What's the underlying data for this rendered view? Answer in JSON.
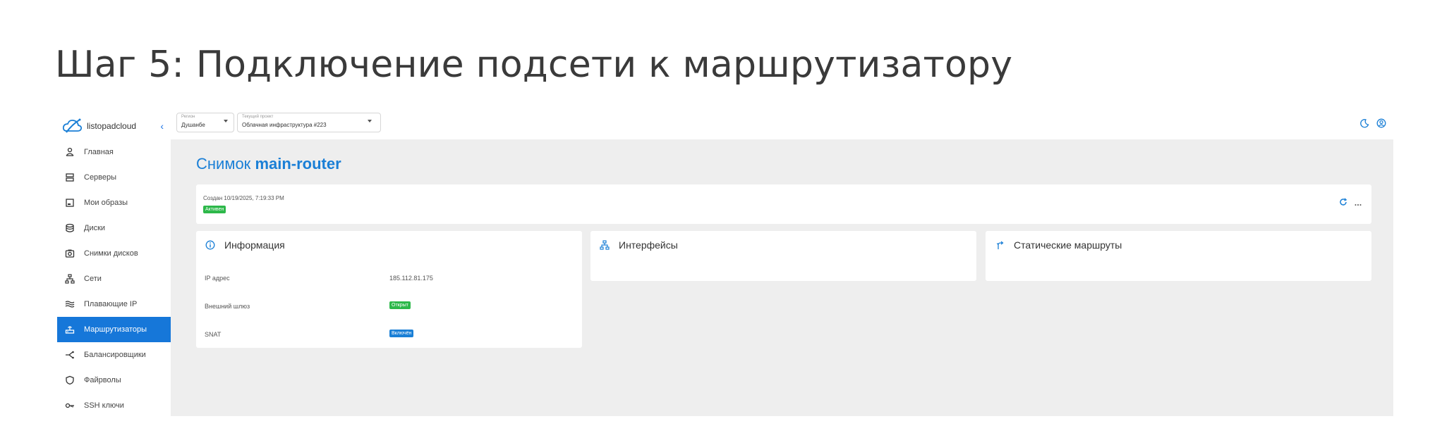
{
  "slide": {
    "title": "Шаг 5: Подключение подсети к маршрутизатору"
  },
  "brand": {
    "name": "listopadcloud",
    "collapse_icon": "chevron-left-icon"
  },
  "sidebar": {
    "items": [
      {
        "label": "Главная",
        "icon": "user-icon"
      },
      {
        "label": "Серверы",
        "icon": "server-icon"
      },
      {
        "label": "Мои образы",
        "icon": "image-icon"
      },
      {
        "label": "Диски",
        "icon": "database-icon"
      },
      {
        "label": "Снимки дисков",
        "icon": "camera-icon"
      },
      {
        "label": "Сети",
        "icon": "network-icon"
      },
      {
        "label": "Плавающие IP",
        "icon": "waves-icon"
      },
      {
        "label": "Маршрутизаторы",
        "icon": "router-icon",
        "active": true
      },
      {
        "label": "Балансировщики",
        "icon": "balancer-icon"
      },
      {
        "label": "Файрволы",
        "icon": "shield-icon"
      },
      {
        "label": "SSH ключи",
        "icon": "key-icon"
      }
    ]
  },
  "topbar": {
    "region_label": "Регион",
    "region_value": "Душанбе",
    "project_label": "Текущий проект",
    "project_value": "Облачная инфраструктура #223"
  },
  "main": {
    "title_prefix": "Снимок",
    "title_name": "main-router",
    "created": "Создан 10/19/2025, 7:19:33 PM",
    "status_badge": "Активен",
    "info": {
      "title": "Информация",
      "rows": [
        {
          "label": "IP адрес",
          "value": "185.112.81.175"
        },
        {
          "label": "Внешний шлюз",
          "badge": "Открыт"
        },
        {
          "label": "SNAT",
          "badge": "Включён"
        }
      ]
    },
    "interfaces": {
      "title": "Интерфейсы"
    },
    "routes": {
      "title": "Статические маршруты"
    }
  },
  "colors": {
    "accent": "#1677d9",
    "title_blue": "#1a7fd6",
    "success": "#2db84a",
    "background": "#eeeeee"
  }
}
